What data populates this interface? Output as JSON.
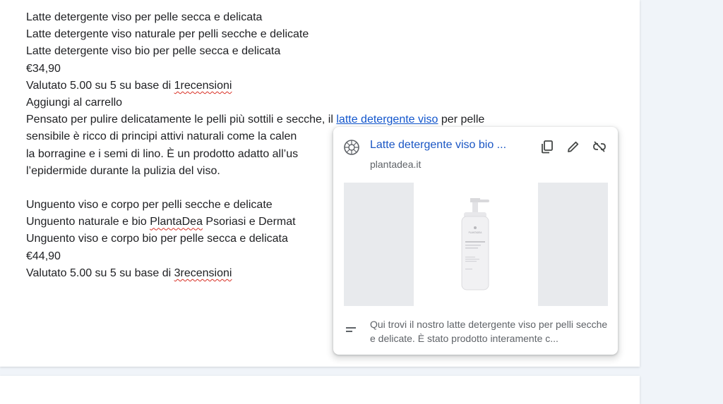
{
  "document": {
    "lines": [
      "Latte detergente viso per pelle secca e delicata",
      "Latte detergente viso naturale per pelli secche e delicate",
      "Latte detergente viso bio per pelle secca e delicata",
      "€34,90",
      "Aggiungi al carrello",
      "la borragine e i semi di lino. È un prodotto adatto all’us",
      "l’epidermide durante la pulizia del viso.",
      "Unguento viso e corpo per pelli secche e delicate",
      "Unguento viso e corpo bio per pelle secca e delicata",
      "€44,90"
    ],
    "rating1": {
      "prefix": "Valutato 5.00 su 5 su base di ",
      "link": "1recensioni"
    },
    "paragraph": {
      "prefix": "Pensato per pulire delicatamente le pelli più sottili e secche, il ",
      "link": "latte detergente viso",
      "suffix": " per pelle"
    },
    "paragraph_line2": "sensibile è ricco di principi attivi naturali come la calen",
    "unguento_naturale": {
      "prefix": "Unguento naturale e bio ",
      "brand": "PlantaDea",
      "suffix": " Psoriasi e Dermat"
    },
    "rating2": {
      "prefix": "Valutato 5.00 su 5 su base di ",
      "link": "3recensioni"
    }
  },
  "link_preview": {
    "title": "Latte detergente viso bio ...",
    "domain": "plantadea.it",
    "description": "Qui trovi il nostro latte detergente viso per pelli secche e delicate. È stato prodotto interamente c...",
    "icons": {
      "site": "globe-icon",
      "copy": "copy-icon",
      "edit": "edit-pencil-icon",
      "unlink": "remove-link-icon",
      "description": "short-text-icon"
    },
    "bottle_label": "PLANTADEA"
  },
  "colors": {
    "link": "#1155cc",
    "accent": "#1a56c4",
    "spellcheck": "#d93025"
  }
}
